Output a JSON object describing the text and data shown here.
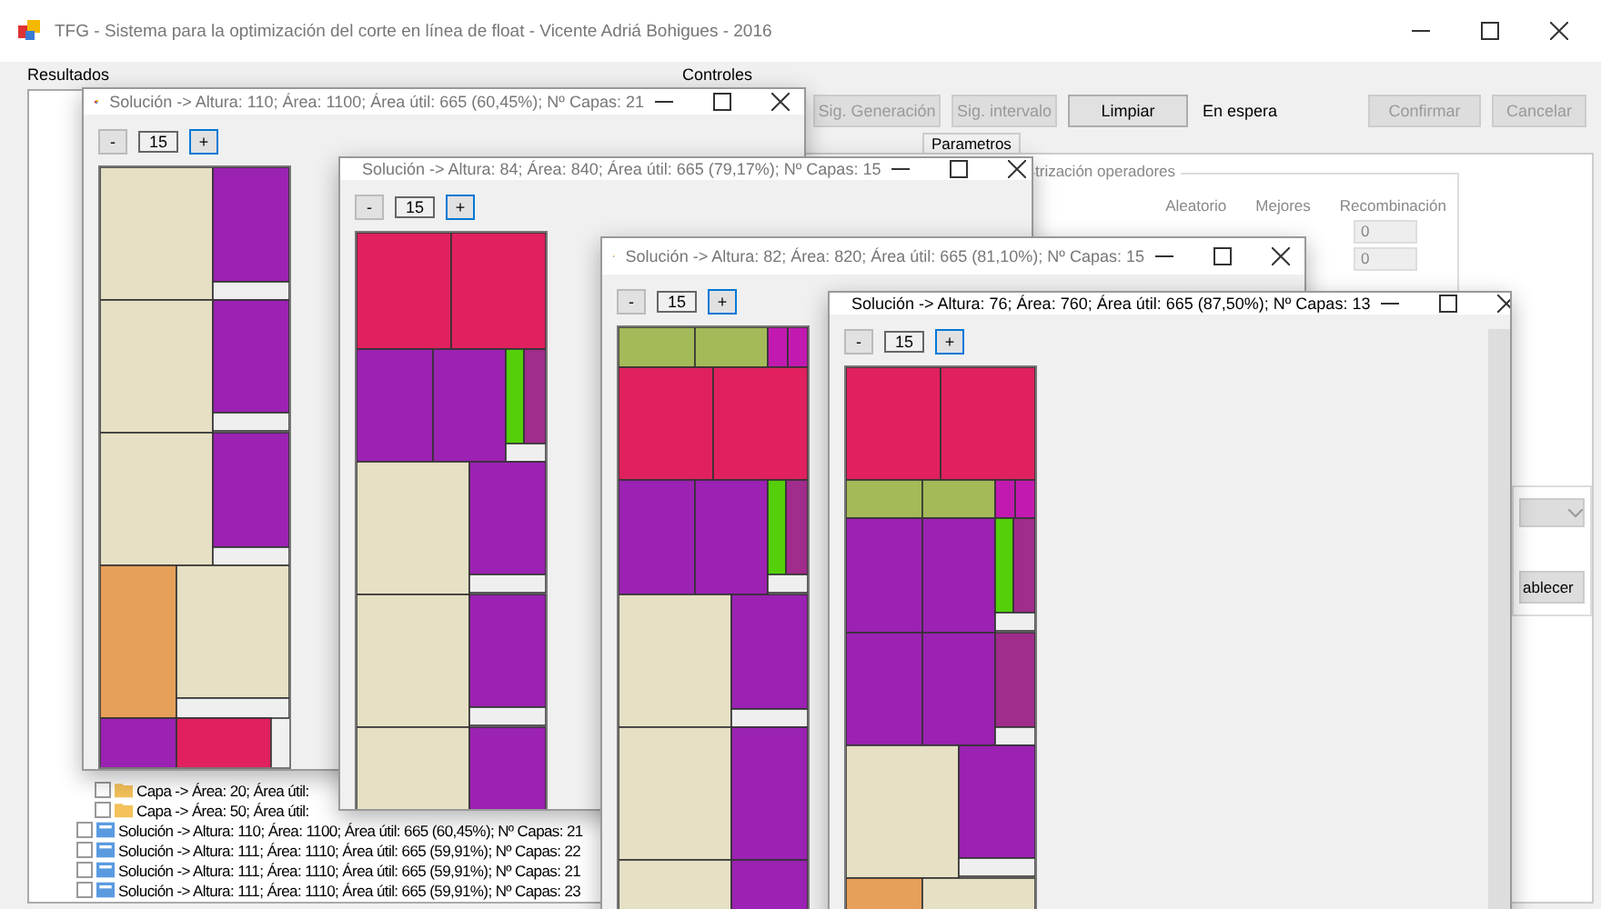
{
  "window": {
    "title": "TFG - Sistema para la optimización del corte en línea de float - Vicente Adriá Bohigues - 2016"
  },
  "results": {
    "label": "Resultados",
    "items": [
      {
        "kind": "layer",
        "label": "Capa -> Área: 20; Área útil:"
      },
      {
        "kind": "layer",
        "label": "Capa -> Área: 50; Área útil:"
      },
      {
        "kind": "solution",
        "label": "Solución -> Altura: 110; Área: 1100; Área útil: 665 (60,45%); Nº Capas: 21"
      },
      {
        "kind": "solution",
        "label": "Solución -> Altura: 111; Área: 1110; Área útil: 665 (59,91%); Nº Capas: 22"
      },
      {
        "kind": "solution",
        "label": "Solución -> Altura: 111; Área: 1110; Área útil: 665 (59,91%); Nº Capas: 21"
      },
      {
        "kind": "solution",
        "label": "Solución -> Altura: 111; Área: 1110; Área útil: 665 (59,91%); Nº Capas: 23"
      }
    ]
  },
  "controls": {
    "label": "Controles",
    "buttons": [
      {
        "label": "Sig. Generación",
        "disabled": true
      },
      {
        "label": "Sig. intervalo",
        "disabled": true
      },
      {
        "label": "Limpiar",
        "disabled": false
      }
    ],
    "status": "En espera",
    "actions": [
      {
        "label": "Confirmar",
        "disabled": true
      },
      {
        "label": "Cancelar",
        "disabled": true
      }
    ],
    "tab": "Parametros",
    "group": {
      "label": "trización operadores",
      "columns": [
        "Aleatorio",
        "Mejores",
        "Recombinación"
      ],
      "values": [
        "0",
        "0"
      ]
    },
    "reset_button": "ablecer"
  },
  "solutions": [
    {
      "title": "Solución -> Altura: 110; Área: 1100; Área útil: 665 (60,45%); Nº Capas: 21",
      "minus": "-",
      "zoom": "15",
      "plus": "+"
    },
    {
      "title": "Solución -> Altura: 84; Área: 840; Área útil: 665 (79,17%); Nº Capas: 15",
      "minus": "-",
      "zoom": "15",
      "plus": "+"
    },
    {
      "title": "Solución -> Altura: 82; Área: 820; Área útil: 665 (81,10%); Nº Capas: 15",
      "minus": "-",
      "zoom": "15",
      "plus": "+"
    },
    {
      "title": "Solución -> Altura: 76; Área: 760; Área útil: 665 (87,50%); Nº Capas: 13",
      "minus": "-",
      "zoom": "15",
      "plus": "+"
    }
  ]
}
